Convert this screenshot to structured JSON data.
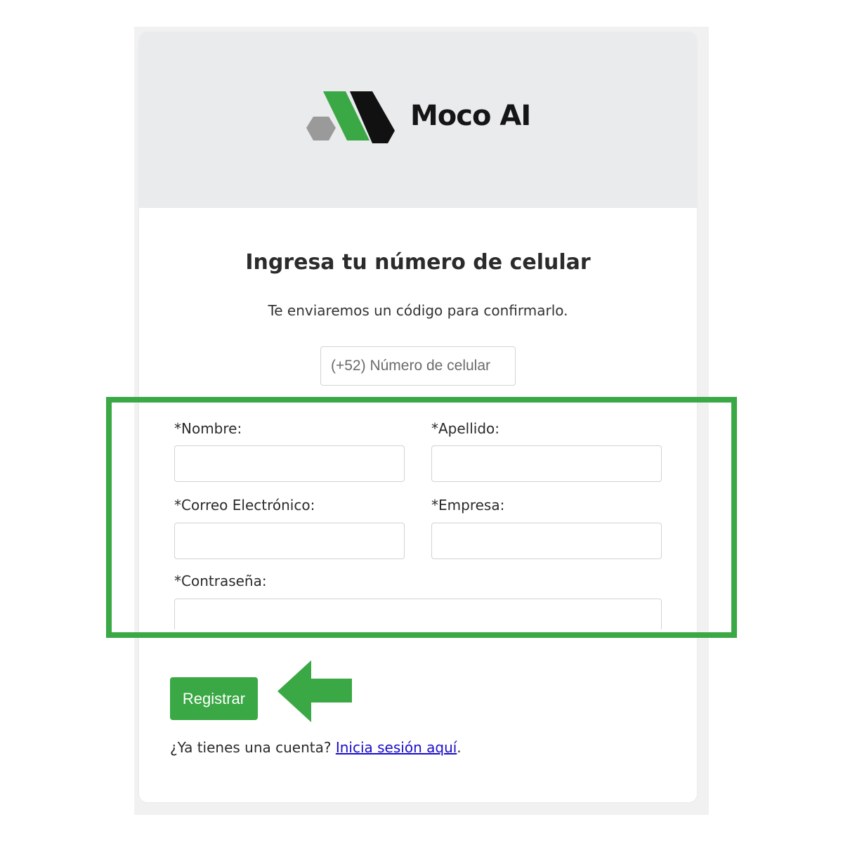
{
  "brand": {
    "name": "Moco AI",
    "logo_colors": {
      "green": "#3aa844",
      "black": "#111111",
      "gray": "#9a9a9a"
    }
  },
  "form": {
    "title": "Ingresa tu número de celular",
    "subtitle": "Te enviaremos un código para confirmarlo.",
    "phone_placeholder": "(+52) Número de celular",
    "fields": {
      "nombre_label": "*Nombre:",
      "apellido_label": "*Apellido:",
      "correo_label": "*Correo Electrónico:",
      "empresa_label": "*Empresa:",
      "contrasena_label": "*Contraseña:"
    },
    "register_label": "Registrar",
    "login_prompt": "¿Ya tienes una cuenta?",
    "login_link": "Inicia sesión aquí",
    "login_period": "."
  },
  "annotation": {
    "highlight_color": "#3aa844",
    "arrow_icon": "arrow-left-icon"
  }
}
